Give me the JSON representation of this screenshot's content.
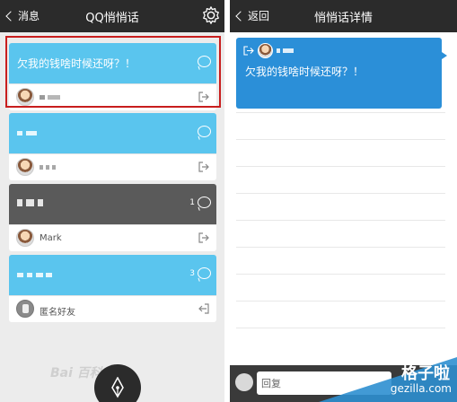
{
  "left": {
    "nav": {
      "back_label": "消息",
      "title": "QQ悄悄话"
    },
    "cards": [
      {
        "message": "欠我的钱啥时候还呀？！",
        "count": "",
        "author": "",
        "color": "#5ac5ee"
      },
      {
        "message": "",
        "count": "",
        "author": "",
        "color": "#5ac5ee"
      },
      {
        "message": "",
        "count": "1",
        "author": "Mark",
        "color": "#5a5a5a"
      },
      {
        "message": "",
        "count": "3",
        "author": "匿名好友",
        "color": "#5ac5ee"
      }
    ]
  },
  "right": {
    "nav": {
      "back_label": "返回",
      "title": "悄悄话详情"
    },
    "detail": {
      "message": "欠我的钱啥时候还呀？！"
    },
    "reply": {
      "placeholder": "回复"
    }
  },
  "watermarks": {
    "baidu": "Bai 百科",
    "site_cn": "格子啦",
    "site_url": "gezilla.com"
  },
  "colors": {
    "nav": "#2b2b2b",
    "blue": "#5ac5ee",
    "dark": "#5a5a5a",
    "detail_blue": "#2b8fd8",
    "selection": "#c81e1e"
  }
}
